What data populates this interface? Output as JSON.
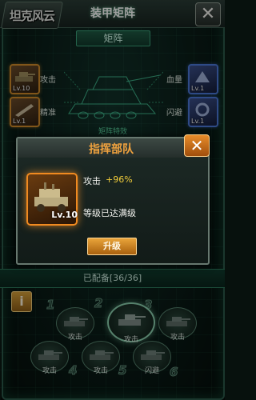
{
  "header": {
    "logo_text": "坦克风云",
    "title": "装甲矩阵",
    "close_icon": "close-icon"
  },
  "matrix": {
    "section_label": "矩阵",
    "effect_label": "矩阵特效",
    "left_slots": [
      {
        "label": "攻击",
        "level": "Lv.10"
      },
      {
        "label": "精准",
        "level": "Lv.1"
      }
    ],
    "right_slots": [
      {
        "label": "血量",
        "level": "Lv.1"
      },
      {
        "label": "闪避",
        "level": "Lv.1"
      }
    ]
  },
  "popup": {
    "title": "指挥部队",
    "unit_level": "Lv.10",
    "stat_name": "攻击",
    "stat_value": "+96%",
    "max_level_text": "等级已达满级",
    "upgrade_label": "升级"
  },
  "formation": {
    "equipped_label": "已配备[36/36]",
    "info_icon_label": "i",
    "slot_numbers": [
      "1",
      "2",
      "3",
      "4",
      "5",
      "6"
    ],
    "slots": [
      {
        "label": "攻击"
      },
      {
        "label": "攻击"
      },
      {
        "label": "攻击"
      },
      {
        "label": "攻击"
      },
      {
        "label": "攻击"
      },
      {
        "label": "闪避"
      }
    ]
  },
  "colors": {
    "accent_orange": "#f0a23e",
    "stat_yellow": "#f1cc3a",
    "frame_green": "#2a5a4a"
  }
}
